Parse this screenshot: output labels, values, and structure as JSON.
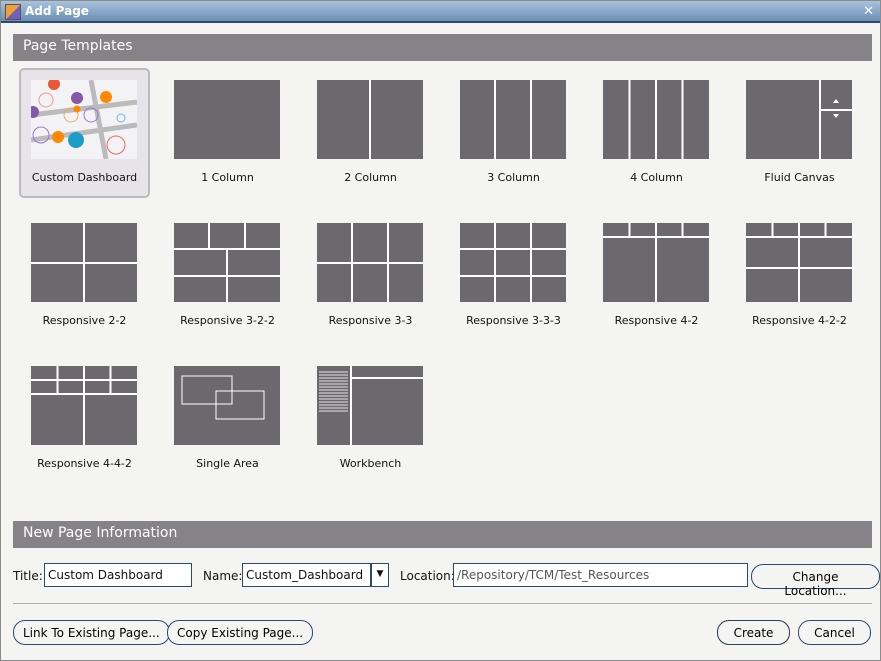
{
  "window": {
    "title": "Add Page",
    "close_icon": "close-icon"
  },
  "templates_section": "Page Templates",
  "templates": [
    {
      "label": "Custom Dashboard",
      "selected": true
    },
    {
      "label": "1 Column"
    },
    {
      "label": "2 Column"
    },
    {
      "label": "3 Column"
    },
    {
      "label": "4 Column"
    },
    {
      "label": "Fluid Canvas"
    },
    {
      "label": "Responsive 2-2"
    },
    {
      "label": "Responsive 3-2-2"
    },
    {
      "label": "Responsive 3-3"
    },
    {
      "label": "Responsive 3-3-3"
    },
    {
      "label": "Responsive 4-2"
    },
    {
      "label": "Responsive 4-2-2"
    },
    {
      "label": "Responsive 4-4-2"
    },
    {
      "label": "Single Area"
    },
    {
      "label": "Workbench"
    }
  ],
  "info_section": "New Page Information",
  "form": {
    "title_label": "Title:",
    "title_value": "Custom Dashboard",
    "name_label": "Name:",
    "name_value": "Custom_Dashboard",
    "location_label": "Location:",
    "location_value": "/Repository/TCM/Test_Resources",
    "change_location": "Change Location..."
  },
  "buttons": {
    "link": "Link To Existing Page...",
    "copy": "Copy Existing Page...",
    "create": "Create",
    "cancel": "Cancel"
  },
  "colors": {
    "thumb": "#6b696d",
    "header": "#858387",
    "border": "#2d4a6c"
  }
}
